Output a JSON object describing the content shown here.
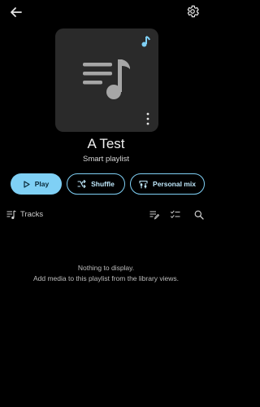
{
  "playlist": {
    "title": "A Test",
    "subtitle": "Smart playlist"
  },
  "actions": {
    "play_label": "Play",
    "shuffle_label": "Shuffle",
    "mix_label": "Personal mix"
  },
  "tracks": {
    "label": "Tracks"
  },
  "empty_state": {
    "line1": "Nothing to display.",
    "line2": "Add media to this playlist from the library views."
  },
  "colors": {
    "accent": "#7fd0f5",
    "background": "#000000",
    "cover": "#2a2a2a"
  },
  "icons": [
    "back-arrow-icon",
    "gear-icon",
    "music-note-icon",
    "more-vertical-icon",
    "play-icon",
    "shuffle-icon",
    "personal-mix-icon",
    "queue-music-icon",
    "edit-list-icon",
    "checklist-icon",
    "search-icon"
  ]
}
